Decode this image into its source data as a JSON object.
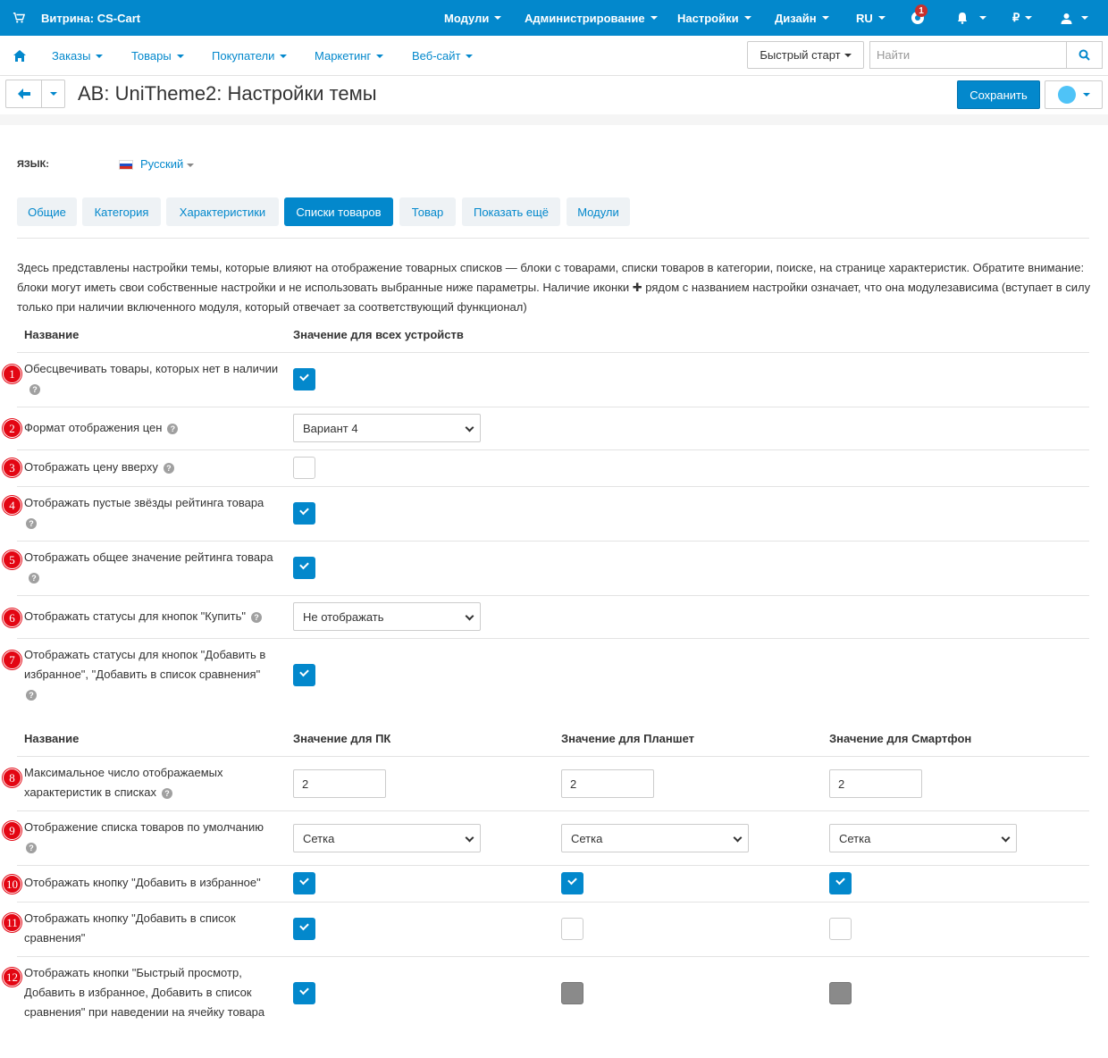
{
  "topbar": {
    "brand": "Витрина: CS-Cart",
    "modules": "Модули",
    "admin": "Администрирование",
    "settings": "Настройки",
    "design": "Дизайн",
    "lang": "RU",
    "notifications_count": "1",
    "currency": "₽",
    "color": "#0388cc"
  },
  "nav": {
    "orders": "Заказы",
    "products": "Товары",
    "customers": "Покупатели",
    "marketing": "Маркетинг",
    "website": "Веб-сайт",
    "quick_start": "Быстрый старт",
    "search_placeholder": "Найти"
  },
  "page": {
    "title": "AB: UniTheme2: Настройки темы",
    "save": "Сохранить"
  },
  "language": {
    "label": "ЯЗЫК:",
    "value": "Русский"
  },
  "tabs": [
    "Общие",
    "Категория",
    "Характеристики",
    "Списки товаров",
    "Товар",
    "Показать ещё",
    "Модули"
  ],
  "active_tab": "Списки товаров",
  "description": "Здесь представлены настройки темы, которые влияют на отображение товарных списков — блоки с товарами, списки товаров в категории, поиске, на странице характеристик. Обратите внимание: блоки могут иметь свои собственные настройки и не использовать выбранные ниже параметры. Наличие иконки ✚ рядом с названием настройки означает, что она модулезависима (вступает в силу только при наличии включенного модуля, который отвечает за соответствующий функционал)",
  "table1": {
    "col_name": "Название",
    "col_all": "Значение для всех устройств"
  },
  "table2": {
    "col_name": "Название",
    "col_pc": "Значение для ПК",
    "col_tablet": "Значение для Планшет",
    "col_phone": "Значение для Смартфон"
  },
  "rows": [
    {
      "n": "1",
      "label": "Обесцвечивать товары, которых нет в наличии",
      "value": true
    },
    {
      "n": "2",
      "label": "Формат отображения цен",
      "value": "Вариант 4"
    },
    {
      "n": "3",
      "label": "Отображать цену вверху",
      "value": false
    },
    {
      "n": "4",
      "label": "Отображать пустые звёзды рейтинга товара",
      "value": true
    },
    {
      "n": "5",
      "label": "Отображать общее значение рейтинга товара",
      "value": true
    },
    {
      "n": "6",
      "label": "Отображать статусы для кнопок \"Купить\"",
      "value": "Не отображать"
    },
    {
      "n": "7",
      "label": "Отображать статусы для кнопок \"Добавить в избранное\", \"Добавить в список сравнения\"",
      "value": true
    },
    {
      "n": "8",
      "label": "Максимальное число отображаемых характеристик в списках",
      "pc": "2",
      "tablet": "2",
      "phone": "2"
    },
    {
      "n": "9",
      "label": "Отображение списка товаров по умолчанию",
      "pc": "Сетка",
      "tablet": "Сетка",
      "phone": "Сетка"
    },
    {
      "n": "10",
      "label": "Отображать кнопку \"Добавить в избранное\"",
      "pc": true,
      "tablet": true,
      "phone": true
    },
    {
      "n": "11",
      "label": "Отображать кнопку \"Добавить в список сравнения\"",
      "pc": true,
      "tablet": false,
      "phone": false
    },
    {
      "n": "12",
      "label": "Отображать кнопки \"Быстрый просмотр, Добавить в избранное, Добавить в список сравнения\" при наведении на ячейку товара",
      "pc": true,
      "tablet": "disabled",
      "phone": "disabled"
    }
  ]
}
